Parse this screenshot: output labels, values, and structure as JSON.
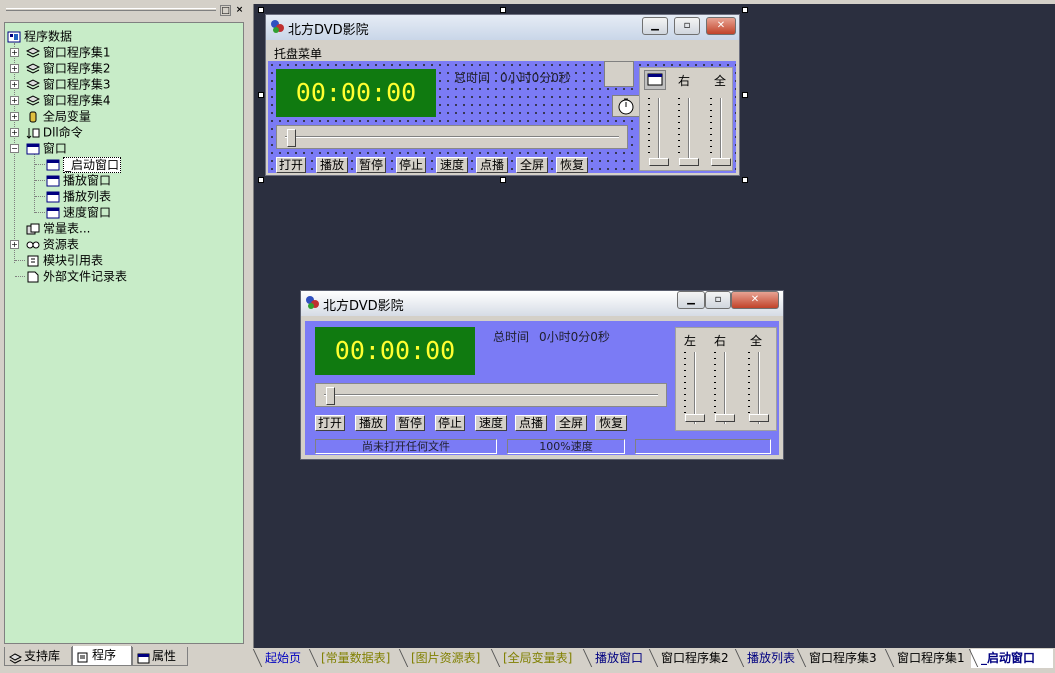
{
  "left_panel": {
    "tree": {
      "root": "程序数据",
      "items": [
        {
          "label": "窗口程序集1"
        },
        {
          "label": "窗口程序集2"
        },
        {
          "label": "窗口程序集3"
        },
        {
          "label": "窗口程序集4"
        },
        {
          "label": "全局变量"
        },
        {
          "label": "Dll命令"
        },
        {
          "label": "窗口"
        },
        {
          "label": "_启动窗口"
        },
        {
          "label": "播放窗口"
        },
        {
          "label": "播放列表"
        },
        {
          "label": "速度窗口"
        },
        {
          "label": "常量表..."
        },
        {
          "label": "资源表"
        },
        {
          "label": "模块引用表"
        },
        {
          "label": "外部文件记录表"
        }
      ]
    },
    "tabs": [
      {
        "label": "支持库"
      },
      {
        "label": "程序"
      },
      {
        "label": "属性"
      }
    ],
    "title_buttons": {
      "restore": "□",
      "close": "×"
    }
  },
  "design_window": {
    "title": "北方DVD影院",
    "menu": "托盘菜单",
    "time_display": "00:00:00",
    "total_time_label": "总时间",
    "total_time_value": "0小时0分0秒",
    "buttons": [
      "打开",
      "播放",
      "暂停",
      "停止",
      "速度",
      "点播",
      "全屏",
      "恢复"
    ],
    "volume_labels": [
      "右",
      "全"
    ]
  },
  "preview_window": {
    "title": "北方DVD影院",
    "time_display": "00:00:00",
    "total_time_label": "总时间",
    "total_time_value": "0小时0分0秒",
    "buttons": [
      "打开",
      "播放",
      "暂停",
      "停止",
      "速度",
      "点播",
      "全屏",
      "恢复"
    ],
    "volume_labels": [
      "左",
      "右",
      "全"
    ],
    "status": [
      "尚未打开任何文件",
      "100%速度",
      ""
    ]
  },
  "bottom_tabs": [
    {
      "label": "起始页",
      "color": "#0000c0"
    },
    {
      "label": "[常量数据表]",
      "color": "#808000"
    },
    {
      "label": "[图片资源表]",
      "color": "#808000"
    },
    {
      "label": "[全局变量表]",
      "color": "#808000"
    },
    {
      "label": "播放窗口",
      "color": "#000080"
    },
    {
      "label": "窗口程序集2",
      "color": "#000000"
    },
    {
      "label": "播放列表",
      "color": "#000080"
    },
    {
      "label": "窗口程序集3",
      "color": "#000000"
    },
    {
      "label": "窗口程序集1",
      "color": "#000000"
    },
    {
      "label": "_启动窗口",
      "color": "#000080"
    }
  ],
  "colors": {
    "workspace": "#2b2f3f",
    "tree_bg": "#c8ecc8",
    "lavender": "#7b7bf5",
    "lcd_bg": "#107a10",
    "lcd_fg": "#ffff30"
  }
}
